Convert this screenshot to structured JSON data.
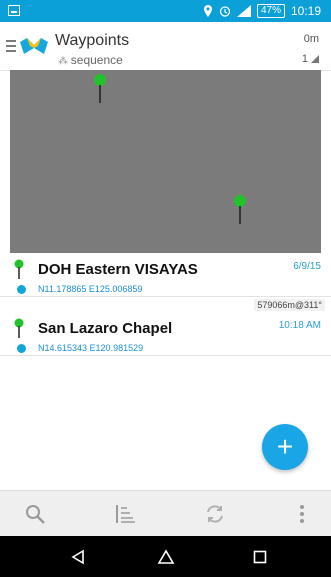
{
  "status_bar": {
    "battery": "47%",
    "time": "10:19"
  },
  "header": {
    "title": "Waypoints",
    "subtitle": "sequence",
    "distance": "0m",
    "count": "1"
  },
  "waypoints": [
    {
      "name": "DOH Eastern VISAYAS",
      "coords": "N11.178865 E125.006859",
      "meta": "6/9/15"
    },
    {
      "name": "San Lazaro Chapel",
      "coords": "N14.615343 E120.981529",
      "meta": "10:18 AM"
    }
  ],
  "between_tag": "579066m@311°",
  "fab": {
    "label": "+"
  },
  "colors": {
    "status_bar": "#0ba0d8",
    "accent": "#1aa6e6",
    "pin": "#22c22b"
  }
}
